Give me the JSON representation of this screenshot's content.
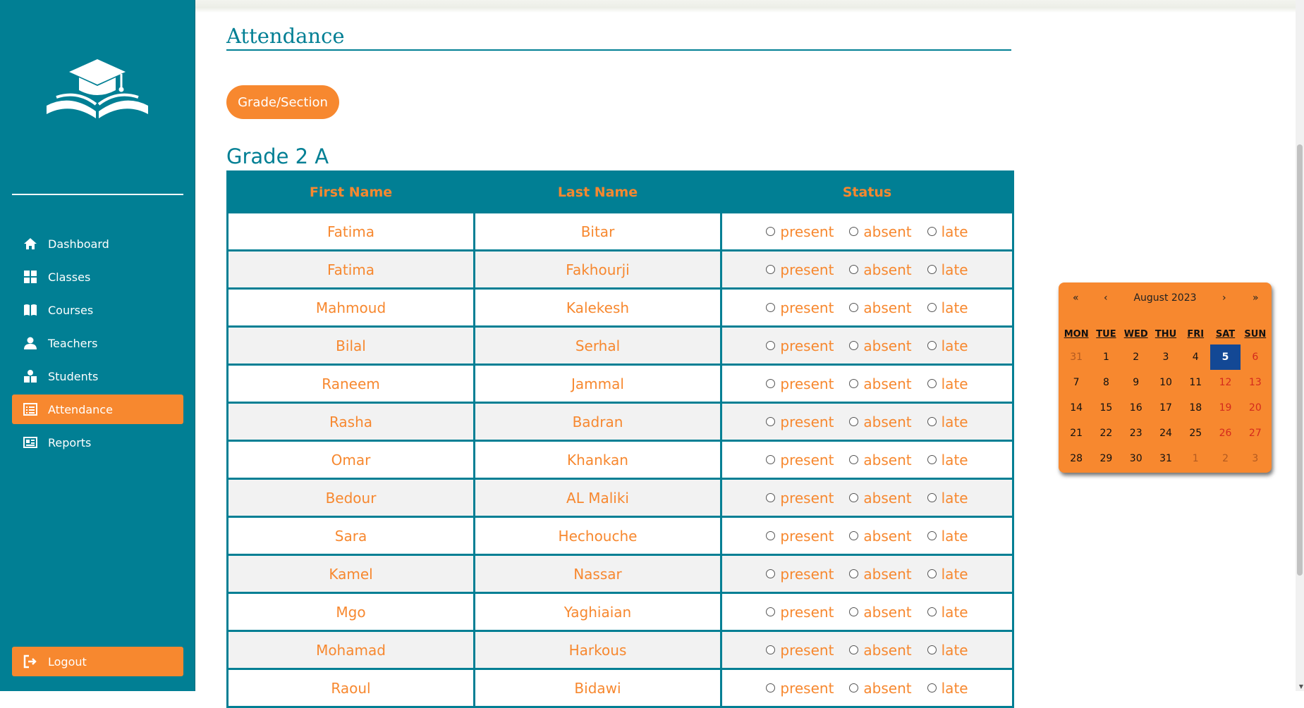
{
  "sidebar": {
    "nav": [
      {
        "label": "Dashboard",
        "icon": "home-icon",
        "active": false
      },
      {
        "label": "Classes",
        "icon": "grid-icon",
        "active": false
      },
      {
        "label": "Courses",
        "icon": "book-icon",
        "active": false
      },
      {
        "label": "Teachers",
        "icon": "user-icon",
        "active": false
      },
      {
        "label": "Students",
        "icon": "students-icon",
        "active": false
      },
      {
        "label": "Attendance",
        "icon": "list-icon",
        "active": true
      },
      {
        "label": "Reports",
        "icon": "report-icon",
        "active": false
      }
    ],
    "logout_label": "Logout"
  },
  "page": {
    "title": "Attendance",
    "grade_button": "Grade/Section",
    "section_title": "Grade 2 A"
  },
  "table": {
    "headers": [
      "First Name",
      "Last Name",
      "Status"
    ],
    "status_options": [
      "present",
      "absent",
      "late"
    ],
    "rows": [
      {
        "first": "Fatima",
        "last": "Bitar"
      },
      {
        "first": "Fatima",
        "last": "Fakhourji"
      },
      {
        "first": "Mahmoud",
        "last": "Kalekesh"
      },
      {
        "first": "Bilal",
        "last": "Serhal"
      },
      {
        "first": "Raneem",
        "last": "Jammal"
      },
      {
        "first": "Rasha",
        "last": "Badran"
      },
      {
        "first": "Omar",
        "last": "Khankan"
      },
      {
        "first": "Bedour",
        "last": "AL Maliki"
      },
      {
        "first": "Sara",
        "last": "Hechouche"
      },
      {
        "first": "Kamel",
        "last": "Nassar"
      },
      {
        "first": "Mgo",
        "last": "Yaghiaian"
      },
      {
        "first": "Mohamad",
        "last": "Harkous"
      },
      {
        "first": "Raoul",
        "last": "Bidawi"
      }
    ]
  },
  "calendar": {
    "month_label": "August 2023",
    "nav": {
      "prev_year": "«",
      "prev_month": "‹",
      "next_month": "›",
      "next_year": "»"
    },
    "weekdays": [
      "MON",
      "TUE",
      "WED",
      "THU",
      "FRI",
      "SAT",
      "SUN"
    ],
    "weeks": [
      [
        "31",
        "1",
        "2",
        "3",
        "4",
        "5",
        "6"
      ],
      [
        "7",
        "8",
        "9",
        "10",
        "11",
        "12",
        "13"
      ],
      [
        "14",
        "15",
        "16",
        "17",
        "18",
        "19",
        "20"
      ],
      [
        "21",
        "22",
        "23",
        "24",
        "25",
        "26",
        "27"
      ],
      [
        "28",
        "29",
        "30",
        "31",
        "1",
        "2",
        "3"
      ]
    ],
    "selected_day": "5"
  },
  "colors": {
    "teal": "#017f94",
    "orange": "#f7882f",
    "selected": "#134895",
    "weekend": "#d42a1d"
  }
}
